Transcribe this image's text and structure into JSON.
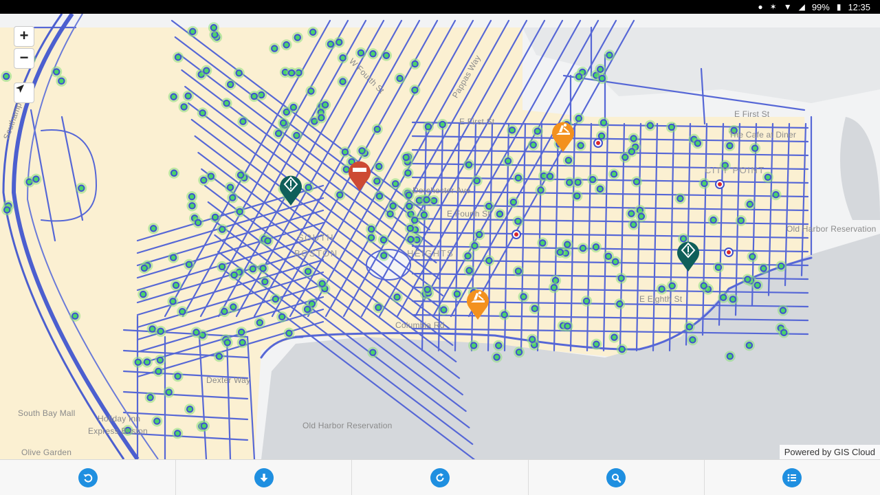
{
  "status_bar": {
    "battery": "99%",
    "time": "12:35",
    "icons": [
      "location-icon",
      "bluetooth-icon",
      "wifi-icon",
      "signal-icon",
      "battery-icon"
    ]
  },
  "map_controls": {
    "zoom_in": "+",
    "zoom_out": "−",
    "locate_icon": "navigation-arrow-icon"
  },
  "attribution": "Powered by GIS Cloud",
  "map_labels": [
    {
      "text": "South Bay Mall"
    },
    {
      "text": "Holiday Inn"
    },
    {
      "text": "Express Boston"
    },
    {
      "text": "Olive Garden"
    },
    {
      "text": "Old Harbor Reservation"
    },
    {
      "text": "Old Harbor Reservation"
    },
    {
      "text": "CITY POINT"
    },
    {
      "text": "The Cafe at Diner"
    },
    {
      "text": "E First St"
    },
    {
      "text": "E Fourth St"
    },
    {
      "text": "E Eighth St"
    },
    {
      "text": "Columbia Rd"
    },
    {
      "text": "SOUTH"
    },
    {
      "text": "BOSTON"
    },
    {
      "text": "HEIGHTS"
    },
    {
      "text": "Dorchester Ave"
    },
    {
      "text": "Southampton St"
    },
    {
      "text": "E First St"
    },
    {
      "text": "Pappas Way"
    },
    {
      "text": "W Fourth St"
    },
    {
      "text": "Dexter Way"
    }
  ],
  "markers": [
    {
      "type": "road-closed",
      "color": "#cd4a33",
      "icon": "no-entry-icon"
    },
    {
      "type": "construction",
      "color": "#f3911e",
      "icon": "construction-icon"
    },
    {
      "type": "construction",
      "color": "#f3911e",
      "icon": "construction-icon"
    },
    {
      "type": "warning",
      "color": "#0f5f5a",
      "icon": "warning-diamond-icon"
    },
    {
      "type": "warning",
      "color": "#0f5f5a",
      "icon": "warning-diamond-icon"
    }
  ],
  "toolbar": [
    {
      "name": "back-button",
      "icon": "back-arrow-icon"
    },
    {
      "name": "download-button",
      "icon": "download-arrow-icon"
    },
    {
      "name": "refresh-button",
      "icon": "refresh-icon"
    },
    {
      "name": "search-button",
      "icon": "search-icon"
    },
    {
      "name": "list-button",
      "icon": "list-icon"
    }
  ],
  "colors": {
    "street": "#5667d6",
    "land": "#fbf0d2",
    "water": "#d5d8dc",
    "point_glow": "#8be07b",
    "point_core": "#3f50d0",
    "toolbar_icon": "#1f8fe0"
  }
}
